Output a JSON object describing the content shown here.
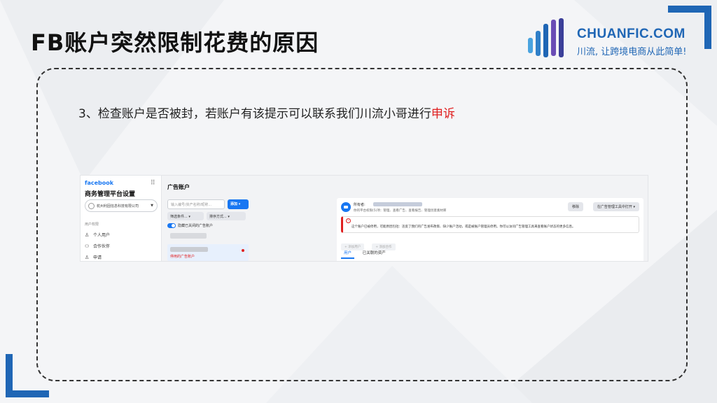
{
  "slide": {
    "title": "FB账户突然限制花费的原因",
    "step_text": "3、检查账户是否被封，若账户有该提示可以联系我们川流小哥进行",
    "step_highlight": "申诉",
    "accent_color": "#1f66b5",
    "highlight_color": "#e02020"
  },
  "logo": {
    "name": "CHUANFIC.COM",
    "slogan": "川流, 让跨境电商从此简单!"
  },
  "screenshot": {
    "sidebar": {
      "brand": "facebook",
      "title": "商务管理平台设置",
      "company": "杭州利固信息科技有限公司",
      "section": "用户权限",
      "items": [
        {
          "label": "个人用户",
          "icon": "person-icon"
        },
        {
          "label": "合作伙伴",
          "icon": "partners-icon"
        },
        {
          "label": "申请",
          "icon": "request-icon"
        }
      ]
    },
    "main": {
      "heading": "广告账户",
      "search_placeholder": "输入编号/资产名称/昵称...",
      "add_button": "添加",
      "filter1": "筛选条件...",
      "filter2": "排序方式...",
      "toggle_label": "隐藏已关闭的广告账户",
      "account_status": "停用的广告账户",
      "detail": {
        "owner_label": "所有者:",
        "meta": "你的平台权限(5)项：管理、查看广告、查看报告、管理创意素材库",
        "remove_button": "移除",
        "open_button": "在广告管理工具中打开",
        "warning": "这个账户已被停用，可能原因包括：违反了我们的广告发布政策、缺少账户活动，或是被账户管理员停用。你可以访问广告管理工具来查看账户状态的更多信息。",
        "add_people": "添加用户",
        "add_partner": "添加合作",
        "tabs": [
          "用户",
          "已关联的资产"
        ]
      }
    }
  }
}
